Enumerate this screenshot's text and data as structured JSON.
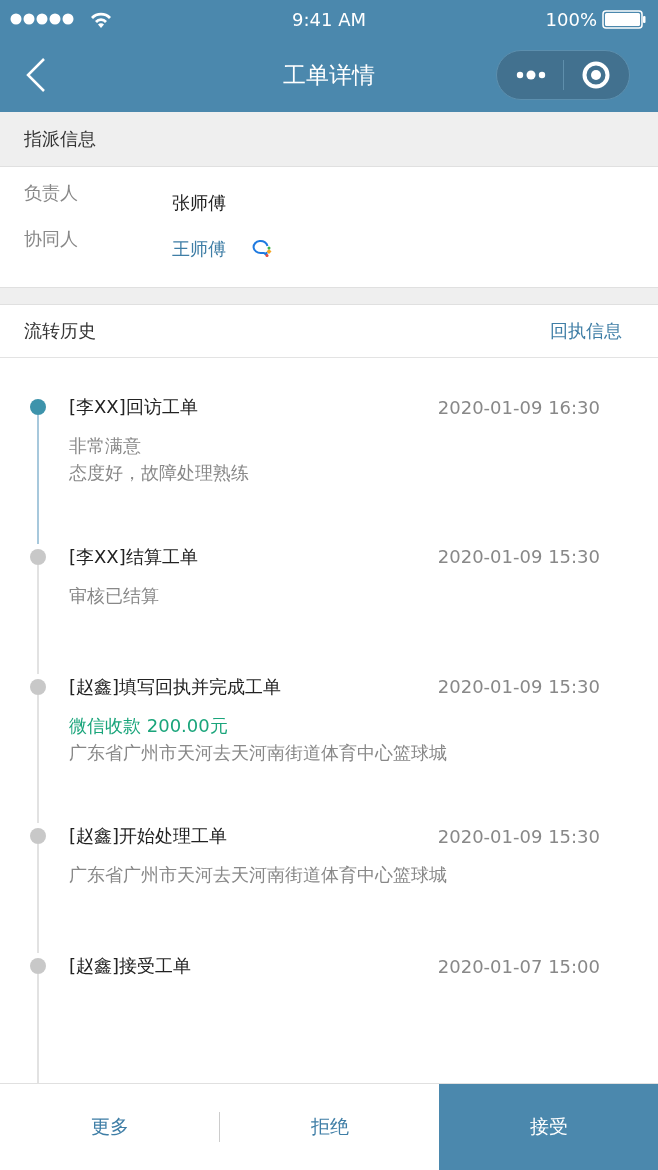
{
  "status_bar": {
    "time": "9:41 AM",
    "battery": "100%"
  },
  "nav": {
    "title": "工单详情"
  },
  "assignment": {
    "heading": "指派信息",
    "rows": [
      {
        "label": "负责人",
        "value": "张师傅",
        "kind": "plain"
      },
      {
        "label": "协同人",
        "value": "王师傅",
        "kind": "chat"
      }
    ]
  },
  "history": {
    "heading": "流转历史",
    "link": "回执信息",
    "items": [
      {
        "title": "[李XX]回访工单",
        "time": "2020-01-09 16:30",
        "current": true,
        "details": [
          {
            "text": "非常满意",
            "kind": "note"
          },
          {
            "text": "态度好，故障处理熟练",
            "kind": "note"
          }
        ]
      },
      {
        "title": "[李XX]结算工单",
        "time": "2020-01-09 15:30",
        "current": false,
        "details": [
          {
            "text": "审核已结算",
            "kind": "note"
          }
        ]
      },
      {
        "title": "[赵鑫]填写回执并完成工单",
        "time": "2020-01-09 15:30",
        "current": false,
        "details": [
          {
            "text": "微信收款 200.00元",
            "kind": "payment"
          },
          {
            "text": "广东省广州市天河去天河南街道体育中心篮球城",
            "kind": "note"
          }
        ]
      },
      {
        "title": "[赵鑫]开始处理工单",
        "time": "2020-01-09 15:30",
        "current": false,
        "details": [
          {
            "text": "广东省广州市天河去天河南街道体育中心篮球城",
            "kind": "note"
          }
        ]
      },
      {
        "title": "[赵鑫]接受工单",
        "time": "2020-01-07 15:00",
        "current": false
      }
    ]
  },
  "actions": [
    {
      "label": "更多",
      "kind": "plain"
    },
    {
      "label": "拒绝",
      "kind": "plain"
    },
    {
      "label": "接受",
      "kind": "primary"
    }
  ]
}
